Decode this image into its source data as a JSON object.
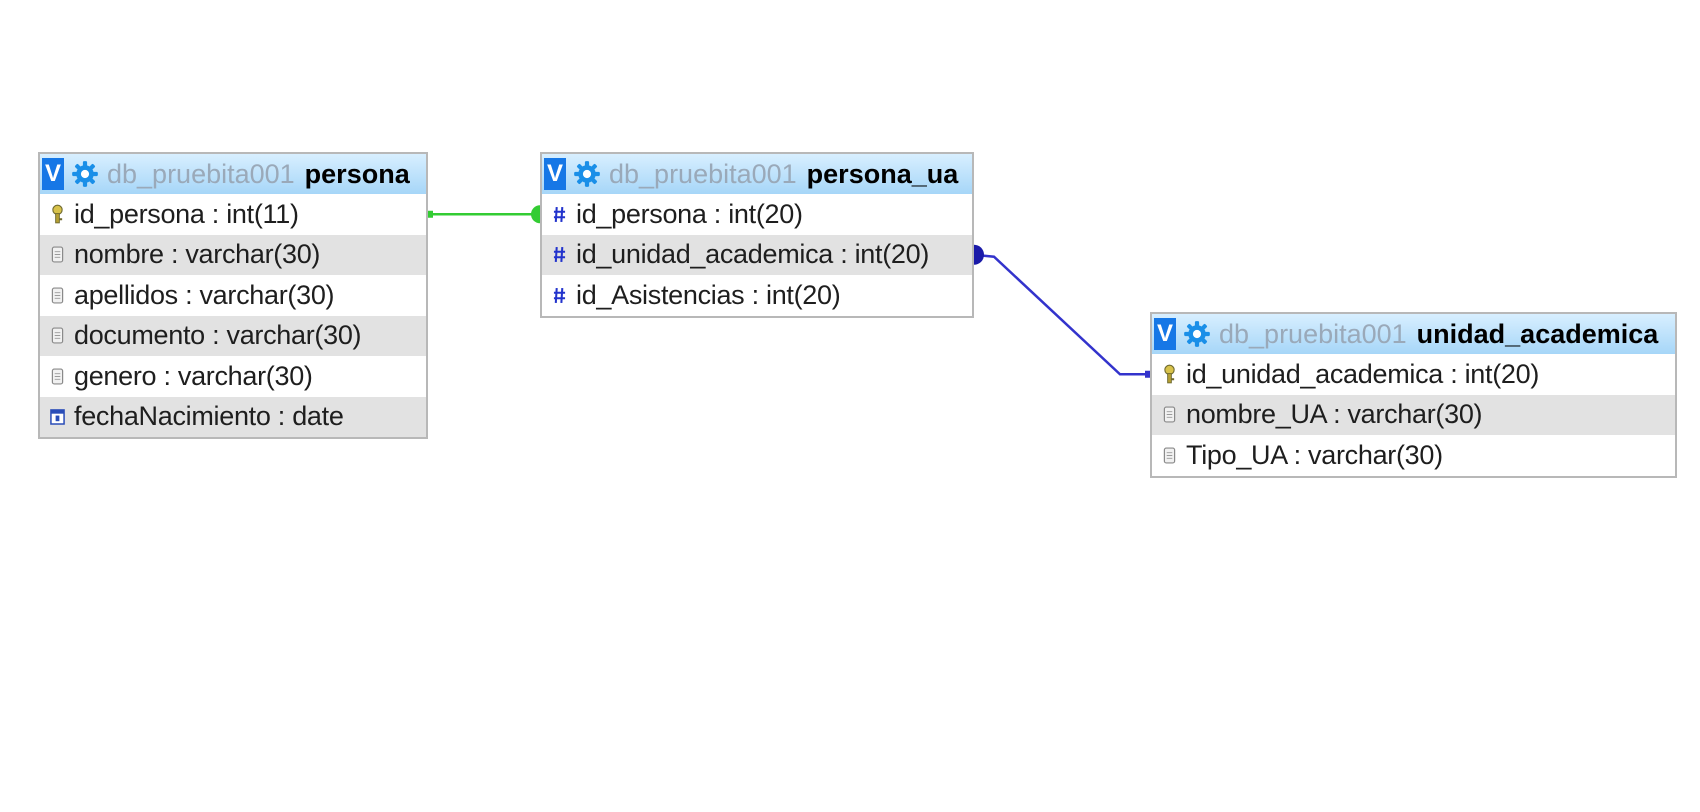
{
  "colors": {
    "header_top": "#d8efff",
    "header_bottom": "#a6d6f8",
    "toggle_button": "#1677e6",
    "db_name_text": "#9aa9b9",
    "alt_row": "#e2e2e2",
    "relation_green": "#33cc33",
    "relation_blue": "#3333cc"
  },
  "tables": [
    {
      "id": "persona",
      "toggle": "V",
      "header_icon": "gear-icon",
      "db": "db_pruebita001",
      "name": "persona",
      "columns": [
        {
          "text": "id_persona : int(11)",
          "icon": "primary-key-icon"
        },
        {
          "text": "nombre : varchar(30)",
          "icon": "text-column-icon"
        },
        {
          "text": "apellidos : varchar(30)",
          "icon": "text-column-icon"
        },
        {
          "text": "documento : varchar(30)",
          "icon": "text-column-icon"
        },
        {
          "text": "genero : varchar(30)",
          "icon": "text-column-icon"
        },
        {
          "text": "fechaNacimiento : date",
          "icon": "date-column-icon"
        }
      ]
    },
    {
      "id": "persona_ua",
      "toggle": "V",
      "header_icon": "gear-icon",
      "db": "db_pruebita001",
      "name": "persona_ua",
      "columns": [
        {
          "text": "id_persona : int(20)",
          "icon": "numeric-column-icon"
        },
        {
          "text": "id_unidad_academica : int(20)",
          "icon": "numeric-column-icon"
        },
        {
          "text": "id_Asistencias : int(20)",
          "icon": "numeric-column-icon"
        }
      ]
    },
    {
      "id": "unidad_academica",
      "toggle": "V",
      "header_icon": "gear-icon",
      "db": "db_pruebita001",
      "name": "unidad_academica",
      "columns": [
        {
          "text": "id_unidad_academica : int(20)",
          "icon": "primary-key-icon"
        },
        {
          "text": "nombre_UA : varchar(30)",
          "icon": "text-column-icon"
        },
        {
          "text": "Tipo_UA : varchar(30)",
          "icon": "text-column-icon"
        }
      ]
    }
  ],
  "relations": [
    {
      "from": "persona.id_persona",
      "to": "persona_ua.id_persona",
      "color": "green"
    },
    {
      "from": "persona_ua.id_unidad_academica",
      "to": "unidad_academica.id_unidad_academica",
      "color": "blue"
    }
  ]
}
